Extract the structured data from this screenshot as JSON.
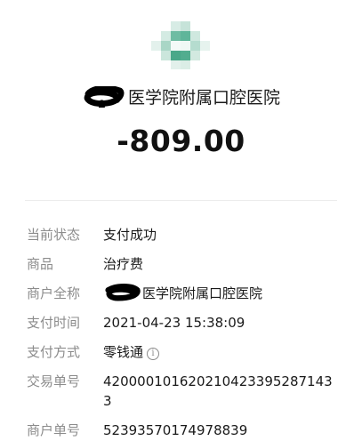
{
  "merchant": {
    "name_visible": "医学院附属口腔医院"
  },
  "amount": "-809.00",
  "details": [
    {
      "label": "当前状态",
      "value": "支付成功"
    },
    {
      "label": "商品",
      "value": "治疗费"
    },
    {
      "label": "商户全称",
      "value": "医学院附属口腔医院"
    },
    {
      "label": "支付时间",
      "value": "2021-04-23 15:38:09"
    },
    {
      "label": "支付方式",
      "value": "零钱通"
    },
    {
      "label": "交易单号",
      "value": "4200001016202104233952871433"
    },
    {
      "label": "商户单号",
      "value": "52393570174978839"
    }
  ],
  "icons": {
    "merchant_logo": "merchant-logo-icon",
    "info": "info-icon"
  },
  "colors": {
    "logo_green": "#5fb59a",
    "label_gray": "#8c8c8c",
    "text": "#1a1a1a",
    "redaction": "#000000"
  }
}
